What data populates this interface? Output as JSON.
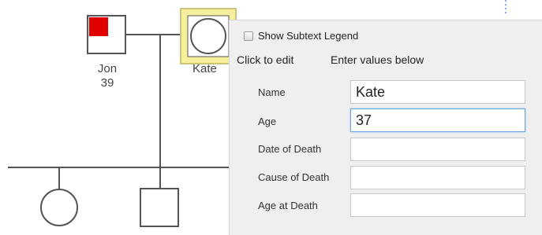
{
  "pedigree": {
    "individuals": [
      {
        "name": "Jon",
        "age": "39",
        "sex": "male",
        "affected": true
      },
      {
        "name": "Kate",
        "sex": "female",
        "selected": true
      },
      {
        "sex": "female"
      },
      {
        "sex": "male"
      }
    ],
    "colors": {
      "affected": "#e00000",
      "selection": "#f6ef9c",
      "selection_border": "#c9c47a",
      "line": "#555555",
      "dotted_marker": "#2a4fd1"
    }
  },
  "panel": {
    "legend_checkbox_label": "Show Subtext Legend",
    "legend_checked": false,
    "click_to_edit": "Click to edit",
    "enter_values": "Enter values below",
    "fields": [
      {
        "label": "Name",
        "value": "Kate"
      },
      {
        "label": "Age",
        "value": "37",
        "focused": true
      },
      {
        "label": "Date of Death",
        "value": ""
      },
      {
        "label": "Cause of Death",
        "value": ""
      },
      {
        "label": "Age at Death",
        "value": ""
      }
    ]
  }
}
